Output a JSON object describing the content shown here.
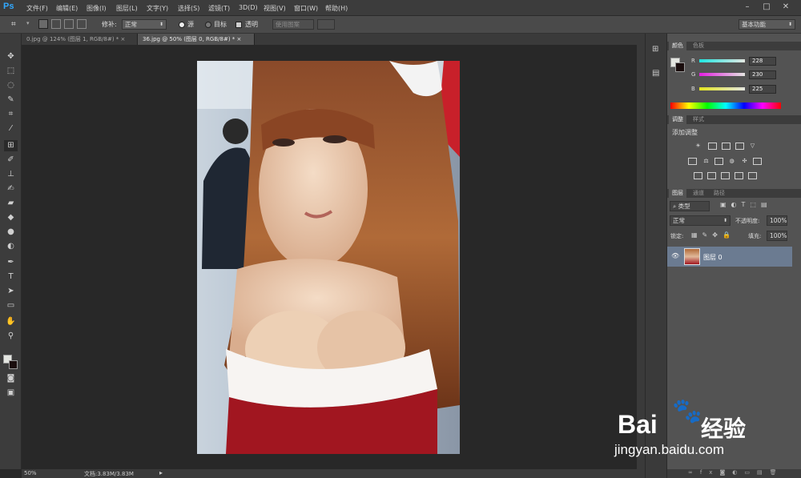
{
  "app": {
    "logo": "Ps"
  },
  "menu": [
    "文件(F)",
    "编辑(E)",
    "图像(I)",
    "图层(L)",
    "文字(Y)",
    "选择(S)",
    "滤镜(T)",
    "3D(D)",
    "视图(V)",
    "窗口(W)",
    "帮助(H)"
  ],
  "window_controls": {
    "minimize": "–",
    "restore": "□",
    "close": "✕"
  },
  "options": {
    "feather_label": "修补:",
    "mode_value": "正常",
    "radio_source": "源",
    "radio_target": "目标",
    "transparent_label": "透明",
    "use_pattern": "使用图案",
    "workspace": "基本功能"
  },
  "tabs": [
    {
      "label": "0.jpg @ 124% (图层 1, RGB/8#) *",
      "close": "×"
    },
    {
      "label": "36.jpg @ 50% (图层 0, RGB/8#) *",
      "close": "×"
    }
  ],
  "status": {
    "zoom": "50%",
    "doc": "文档:3.83M/3.83M"
  },
  "color_panel": {
    "tabs": [
      "颜色",
      "色板"
    ],
    "r_label": "R",
    "g_label": "G",
    "b_label": "B",
    "r": "228",
    "g": "230",
    "b": "225",
    "fg_color": "#e4e6e1",
    "bg_color": "#1a0d0d"
  },
  "adjust_panel": {
    "tabs": [
      "调整",
      "样式"
    ],
    "title": "添加调整"
  },
  "layers_panel": {
    "tabs": [
      "图层",
      "通道",
      "路径"
    ],
    "filter_kind": "类型",
    "blend": "正常",
    "opacity_label": "不透明度:",
    "opacity": "100%",
    "lock_label": "锁定:",
    "fill_label": "填充:",
    "fill": "100%",
    "layer_name": "图层 0"
  },
  "watermark": {
    "brand": "Bai",
    "brand2": "经验",
    "url": "jingyan.baidu.com"
  }
}
